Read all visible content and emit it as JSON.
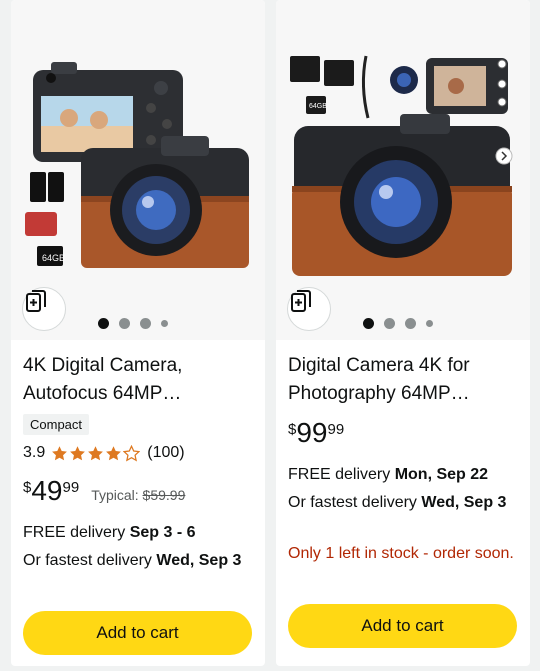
{
  "products": [
    {
      "title": "4K Digital Camera, Autofocus 64MP…",
      "badge": "Compact",
      "rating": "3.9",
      "stars": 3.9,
      "review_count": "(100)",
      "price_symbol": "$",
      "price_whole": "49",
      "price_fraction": "99",
      "typical_label": "Typical:",
      "typical_price": "$59.99",
      "delivery_label": "FREE delivery",
      "delivery_date": "Sep 3 - 6",
      "fastest_label": "Or fastest delivery",
      "fastest_date": "Wed, Sep 3",
      "cart_label": "Add to cart",
      "image_dots": 4,
      "memory_card_text": "64GB"
    },
    {
      "title": "Digital Camera 4K for Photography 64MP…",
      "price_symbol": "$",
      "price_whole": "99",
      "price_fraction": "99",
      "delivery_label": "FREE delivery",
      "delivery_date": "Mon, Sep 22",
      "fastest_label": "Or fastest delivery",
      "fastest_date": "Wed, Sep 3",
      "stock_text": "Only 1 left in stock - order soon.",
      "cart_label": "Add to cart",
      "image_dots": 4,
      "memory_card_text": "64GB"
    }
  ],
  "colors": {
    "cart_button": "#ffd814",
    "star": "#de7921",
    "stock_warning": "#b12704",
    "text": "#0f1111",
    "muted": "#565959"
  },
  "icons": {
    "compare": "compare-cards-icon",
    "star": "star-icon"
  }
}
